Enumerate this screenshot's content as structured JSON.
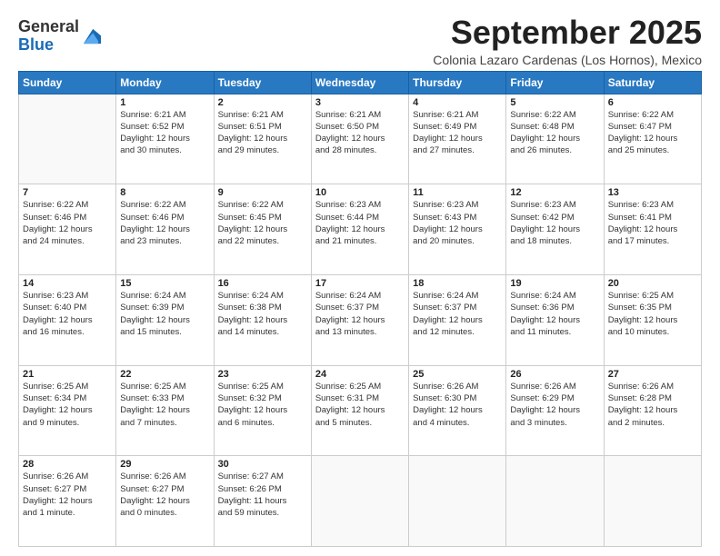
{
  "logo": {
    "general": "General",
    "blue": "Blue"
  },
  "header": {
    "title": "September 2025",
    "subtitle": "Colonia Lazaro Cardenas (Los Hornos), Mexico"
  },
  "days_of_week": [
    "Sunday",
    "Monday",
    "Tuesday",
    "Wednesday",
    "Thursday",
    "Friday",
    "Saturday"
  ],
  "weeks": [
    [
      {
        "day": "",
        "info": ""
      },
      {
        "day": "1",
        "info": "Sunrise: 6:21 AM\nSunset: 6:52 PM\nDaylight: 12 hours\nand 30 minutes."
      },
      {
        "day": "2",
        "info": "Sunrise: 6:21 AM\nSunset: 6:51 PM\nDaylight: 12 hours\nand 29 minutes."
      },
      {
        "day": "3",
        "info": "Sunrise: 6:21 AM\nSunset: 6:50 PM\nDaylight: 12 hours\nand 28 minutes."
      },
      {
        "day": "4",
        "info": "Sunrise: 6:21 AM\nSunset: 6:49 PM\nDaylight: 12 hours\nand 27 minutes."
      },
      {
        "day": "5",
        "info": "Sunrise: 6:22 AM\nSunset: 6:48 PM\nDaylight: 12 hours\nand 26 minutes."
      },
      {
        "day": "6",
        "info": "Sunrise: 6:22 AM\nSunset: 6:47 PM\nDaylight: 12 hours\nand 25 minutes."
      }
    ],
    [
      {
        "day": "7",
        "info": "Sunrise: 6:22 AM\nSunset: 6:46 PM\nDaylight: 12 hours\nand 24 minutes."
      },
      {
        "day": "8",
        "info": "Sunrise: 6:22 AM\nSunset: 6:46 PM\nDaylight: 12 hours\nand 23 minutes."
      },
      {
        "day": "9",
        "info": "Sunrise: 6:22 AM\nSunset: 6:45 PM\nDaylight: 12 hours\nand 22 minutes."
      },
      {
        "day": "10",
        "info": "Sunrise: 6:23 AM\nSunset: 6:44 PM\nDaylight: 12 hours\nand 21 minutes."
      },
      {
        "day": "11",
        "info": "Sunrise: 6:23 AM\nSunset: 6:43 PM\nDaylight: 12 hours\nand 20 minutes."
      },
      {
        "day": "12",
        "info": "Sunrise: 6:23 AM\nSunset: 6:42 PM\nDaylight: 12 hours\nand 18 minutes."
      },
      {
        "day": "13",
        "info": "Sunrise: 6:23 AM\nSunset: 6:41 PM\nDaylight: 12 hours\nand 17 minutes."
      }
    ],
    [
      {
        "day": "14",
        "info": "Sunrise: 6:23 AM\nSunset: 6:40 PM\nDaylight: 12 hours\nand 16 minutes."
      },
      {
        "day": "15",
        "info": "Sunrise: 6:24 AM\nSunset: 6:39 PM\nDaylight: 12 hours\nand 15 minutes."
      },
      {
        "day": "16",
        "info": "Sunrise: 6:24 AM\nSunset: 6:38 PM\nDaylight: 12 hours\nand 14 minutes."
      },
      {
        "day": "17",
        "info": "Sunrise: 6:24 AM\nSunset: 6:37 PM\nDaylight: 12 hours\nand 13 minutes."
      },
      {
        "day": "18",
        "info": "Sunrise: 6:24 AM\nSunset: 6:37 PM\nDaylight: 12 hours\nand 12 minutes."
      },
      {
        "day": "19",
        "info": "Sunrise: 6:24 AM\nSunset: 6:36 PM\nDaylight: 12 hours\nand 11 minutes."
      },
      {
        "day": "20",
        "info": "Sunrise: 6:25 AM\nSunset: 6:35 PM\nDaylight: 12 hours\nand 10 minutes."
      }
    ],
    [
      {
        "day": "21",
        "info": "Sunrise: 6:25 AM\nSunset: 6:34 PM\nDaylight: 12 hours\nand 9 minutes."
      },
      {
        "day": "22",
        "info": "Sunrise: 6:25 AM\nSunset: 6:33 PM\nDaylight: 12 hours\nand 7 minutes."
      },
      {
        "day": "23",
        "info": "Sunrise: 6:25 AM\nSunset: 6:32 PM\nDaylight: 12 hours\nand 6 minutes."
      },
      {
        "day": "24",
        "info": "Sunrise: 6:25 AM\nSunset: 6:31 PM\nDaylight: 12 hours\nand 5 minutes."
      },
      {
        "day": "25",
        "info": "Sunrise: 6:26 AM\nSunset: 6:30 PM\nDaylight: 12 hours\nand 4 minutes."
      },
      {
        "day": "26",
        "info": "Sunrise: 6:26 AM\nSunset: 6:29 PM\nDaylight: 12 hours\nand 3 minutes."
      },
      {
        "day": "27",
        "info": "Sunrise: 6:26 AM\nSunset: 6:28 PM\nDaylight: 12 hours\nand 2 minutes."
      }
    ],
    [
      {
        "day": "28",
        "info": "Sunrise: 6:26 AM\nSunset: 6:27 PM\nDaylight: 12 hours\nand 1 minute."
      },
      {
        "day": "29",
        "info": "Sunrise: 6:26 AM\nSunset: 6:27 PM\nDaylight: 12 hours\nand 0 minutes."
      },
      {
        "day": "30",
        "info": "Sunrise: 6:27 AM\nSunset: 6:26 PM\nDaylight: 11 hours\nand 59 minutes."
      },
      {
        "day": "",
        "info": ""
      },
      {
        "day": "",
        "info": ""
      },
      {
        "day": "",
        "info": ""
      },
      {
        "day": "",
        "info": ""
      }
    ]
  ]
}
